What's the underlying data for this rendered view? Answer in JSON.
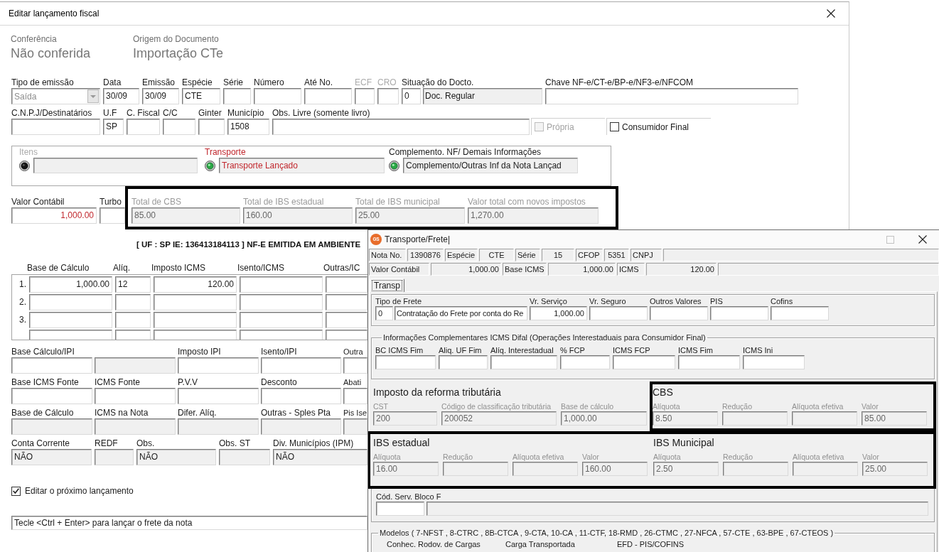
{
  "main_window": {
    "title": "Editar lançamento fiscal",
    "summary": [
      {
        "label": "Conferência",
        "value": "Não conferida"
      },
      {
        "label": "Origem do Documento",
        "value": "Importação CTe"
      }
    ],
    "document_fields": [
      {
        "label": "Tipo de emissão",
        "kind": "combo",
        "value": "Saída"
      },
      {
        "label": "Data",
        "kind": "edit",
        "value": "30/09"
      },
      {
        "label": "Emissão",
        "kind": "edit",
        "value": "30/09"
      },
      {
        "label": "Espécie",
        "kind": "edit",
        "value": "CTE"
      },
      {
        "label": "Série",
        "kind": "edit"
      },
      {
        "label": "Número",
        "kind": "edit"
      },
      {
        "label": "Até No.",
        "kind": "edit"
      },
      {
        "label": "ECF",
        "kind": "muted"
      },
      {
        "label": "CRO",
        "kind": "muted"
      },
      {
        "label": "Situação do Docto.",
        "kind": "coded",
        "code": "0",
        "value": "Doc. Regular"
      },
      {
        "label": "Chave NF-e/CT-e/BP-e/NF3-e/NFCOM",
        "kind": "edit"
      }
    ],
    "recipient_fields": [
      {
        "label": "C.N.P.J/Destinatários"
      },
      {
        "label": "U.F",
        "value": "SP"
      },
      {
        "label": "C. Fiscal"
      },
      {
        "label": "C/C"
      },
      {
        "label": "Ginter"
      },
      {
        "label": "Município",
        "value": "1508"
      },
      {
        "label": "Obs. Livre (somente livro)"
      }
    ],
    "options": [
      {
        "label": "Própria",
        "checked": false,
        "disabled": true
      },
      {
        "label": "Consumidor Final",
        "checked": false,
        "disabled": false
      }
    ],
    "status_panel": [
      {
        "label": "Itens",
        "lit": false,
        "disabled": true,
        "alert": false
      },
      {
        "label": "Transporte",
        "lit": true,
        "disabled": false,
        "alert": true,
        "value": "Transporte Lançado"
      },
      {
        "label": "Complemento. NF/ Demais Informações",
        "lit": true,
        "disabled": false,
        "alert": false,
        "value": "Complemento/Outras Inf da Nota Lançad"
      }
    ],
    "value_fields": [
      {
        "label": "Valor Contábil",
        "alert": true,
        "value": "1,000.00"
      },
      {
        "label": "Turbo"
      }
    ],
    "totals": {
      "highlighted": true,
      "fields": [
        {
          "label": "Total de CBS",
          "value": "85.00"
        },
        {
          "label": "Total de IBS estadual",
          "value": "160.00"
        },
        {
          "label": "Total de IBS municipal",
          "value": "25.00"
        },
        {
          "label": "Valor total com novos impostos",
          "value": "1,270.00"
        }
      ]
    },
    "notice": "[ UF : SP IE: 136413184113 ] NF-E EMITIDA EM AMBIENTE",
    "icms_table": {
      "columns": [
        "Base de Cálculo",
        "Alíq.",
        "Imposto ICMS",
        "Isento/ICMS",
        "Outras/IC"
      ],
      "rows": [
        {
          "number": "1.",
          "cells": [
            "1,000.00",
            "12",
            "120.00"
          ]
        },
        {
          "number": "2."
        },
        {
          "number": "3."
        },
        {}
      ]
    },
    "tax_rows": [
      [
        {
          "label": "Base Cálculo/IPI",
          "kind": "edit"
        },
        {
          "kind": "readonly"
        },
        {
          "label": "Imposto IPI",
          "kind": "edit"
        },
        {
          "label": "Isento/IPI",
          "kind": "edit"
        },
        {
          "label": "Outra",
          "kind": "edit"
        }
      ],
      [
        {
          "label": "Base ICMS Fonte",
          "kind": "edit"
        },
        {
          "label": "ICMS Fonte",
          "kind": "edit"
        },
        {
          "label": "P.V.V",
          "kind": "edit"
        },
        {
          "label": "Desconto",
          "kind": "edit"
        },
        {
          "label": "Abati",
          "kind": "edit"
        }
      ],
      [
        {
          "label": "Base de Cálculo",
          "kind": "readonly"
        },
        {
          "label": "ICMS na Nota",
          "kind": "readonly"
        },
        {
          "label": "Difer. Alíq.",
          "kind": "readonly"
        },
        {
          "label": "Outras - Sples Pta",
          "kind": "readonly"
        },
        {
          "label": "Pis Ise",
          "kind": "readonly"
        }
      ],
      [
        {
          "label": "Conta Corrente",
          "kind": "readonly",
          "value": "NÃO"
        },
        {
          "label": "REDF",
          "kind": "readonly"
        },
        {
          "label": "Obs.",
          "kind": "readonly",
          "value": "NÃO"
        },
        {
          "label": "Obs. ST",
          "kind": "readonly"
        },
        {
          "label": "Div. Municípios (IPM)",
          "kind": "readonly",
          "value": "NÃO"
        }
      ]
    ],
    "edit_next": {
      "label": "Editar o próximo lançamento",
      "checked": true
    },
    "hint": "Tecle <Ctrl + Enter> para lançar o frete da nota"
  },
  "freight_window": {
    "logo": "GS",
    "title": "Transporte/Frete|",
    "info_rows": [
      [
        {
          "kind": "caption",
          "text": "Nota No."
        },
        {
          "kind": "value",
          "text": "1390876"
        },
        {
          "kind": "caption",
          "text": "Espécie"
        },
        {
          "kind": "value",
          "text": "CTE"
        },
        {
          "kind": "caption",
          "text": "Série"
        },
        {
          "kind": "value",
          "text": "15"
        },
        {
          "kind": "caption",
          "text": "CFOP"
        },
        {
          "kind": "value",
          "text": "5351"
        },
        {
          "kind": "caption",
          "text": "CNPJ"
        },
        {
          "kind": "value"
        }
      ],
      [
        {
          "kind": "caption",
          "text": "Valor Contábil"
        },
        {
          "kind": "value",
          "text": "1,000.00"
        },
        {
          "kind": "caption",
          "text": "Base ICMS"
        },
        {
          "kind": "value",
          "text": "1,000.00"
        },
        {
          "kind": "caption",
          "text": "ICMS"
        },
        {
          "kind": "value",
          "text": "120.00"
        },
        {
          "kind": "value"
        }
      ]
    ],
    "tabs": [
      {
        "label": "Transp",
        "selected": true
      }
    ],
    "freight_fields": [
      {
        "label": "Tipo de Frete",
        "kind": "split",
        "code": "0",
        "value": "Contratação do Frete por conta do Re"
      },
      {
        "label": "Vr. Serviço",
        "kind": "edit",
        "value": "1,000.00"
      },
      {
        "label": "Vr. Seguro",
        "kind": "edit"
      },
      {
        "label": "Outros Valores",
        "kind": "edit"
      },
      {
        "label": "PIS",
        "kind": "edit"
      },
      {
        "label": "Cofins",
        "kind": "edit"
      }
    ],
    "difal": {
      "title": "Informações Complementares ICMS Difal (Operações Interestaduais para Consumidor Final)",
      "fields": [
        {
          "label": "BC ICMS Fim"
        },
        {
          "label": "Aliq. UF Fim"
        },
        {
          "label": "Alíq. Interestadual"
        },
        {
          "label": "% FCP"
        },
        {
          "label": "ICMS FCP"
        },
        {
          "label": "ICMS Fim"
        },
        {
          "label": "ICMS Ini"
        }
      ]
    },
    "reform_rows": [
      {
        "highlighted": false,
        "sections": [
          {
            "title": "Imposto da reforma tributária",
            "highlighted": false,
            "fields": [
              {
                "label": "CST",
                "value": "200"
              },
              {
                "label": "Código de classificação tributária",
                "value": "200052"
              },
              {
                "label": "Base de cálculo",
                "value": "1,000.00"
              }
            ]
          },
          {
            "title": "CBS",
            "highlighted": true,
            "fields": [
              {
                "label": "Alíquota",
                "value": "8.50"
              },
              {
                "label": "Redução"
              },
              {
                "label": "Alíquota efetiva"
              },
              {
                "label": "Valor",
                "value": "85.00"
              }
            ]
          }
        ]
      },
      {
        "highlighted": true,
        "sections": [
          {
            "title": "IBS estadual",
            "highlighted": false,
            "fields": [
              {
                "label": "Alíquota",
                "value": "16.00"
              },
              {
                "label": "Redução"
              },
              {
                "label": "Alíquota efetiva"
              },
              {
                "label": "Valor",
                "value": "160.00"
              }
            ]
          },
          {
            "title": "IBS Municipal",
            "highlighted": false,
            "fields": [
              {
                "label": "Alíquota",
                "value": "2.50"
              },
              {
                "label": "Redução"
              },
              {
                "label": "Alíquota efetiva"
              },
              {
                "label": "Valor",
                "value": "25.00"
              }
            ]
          }
        ]
      }
    ],
    "service_code": {
      "label": "Cód. Serv. Bloco F",
      "kind": "coded"
    },
    "models": {
      "title": "Modelos ( 7-NFST , 8-CTRC , 8B-CTCA , 9-CTA, 10-CA , 11-CTF, 18-RMD , 26-CTMC , 27-NFCA , 57-CTE , 63-BPE , 67-CTEOS )",
      "columns": [
        "Conhec. Rodov. de Cargas",
        "Carga Transportada",
        "EFD - PIS/COFINS"
      ]
    }
  }
}
